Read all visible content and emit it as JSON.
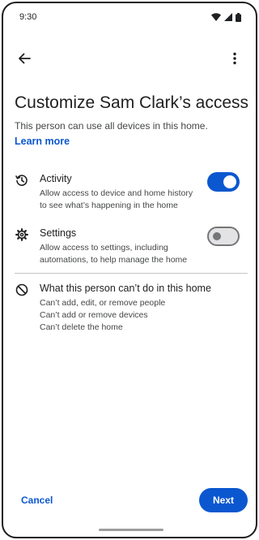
{
  "status_bar": {
    "time": "9:30",
    "icons": [
      "wifi-icon",
      "signal-icon",
      "battery-icon"
    ]
  },
  "app_bar": {
    "back_icon": "arrow-back-icon",
    "more_icon": "more-vert-icon"
  },
  "header": {
    "title": "Customize Sam Clark’s access",
    "subtitle": "This person can use all devices in this home.",
    "learn_more": "Learn more"
  },
  "permissions": [
    {
      "icon": "history-icon",
      "title": "Activity",
      "description": "Allow access to device and home history to see what’s happening in the home",
      "enabled": true
    },
    {
      "icon": "settings-gear-icon",
      "title": "Settings",
      "description": "Allow access to settings, including automations, to help manage the home",
      "enabled": false
    }
  ],
  "restrictions": {
    "icon": "block-icon",
    "title": "What this person can’t do in this home",
    "items": [
      "Can’t add, edit, or remove people",
      "Can’t add or remove devices",
      "Can’t delete the home"
    ]
  },
  "footer": {
    "cancel_label": "Cancel",
    "next_label": "Next"
  },
  "colors": {
    "accent": "#0b57d0",
    "text_primary": "#1f1f1f",
    "text_secondary": "#444746"
  }
}
